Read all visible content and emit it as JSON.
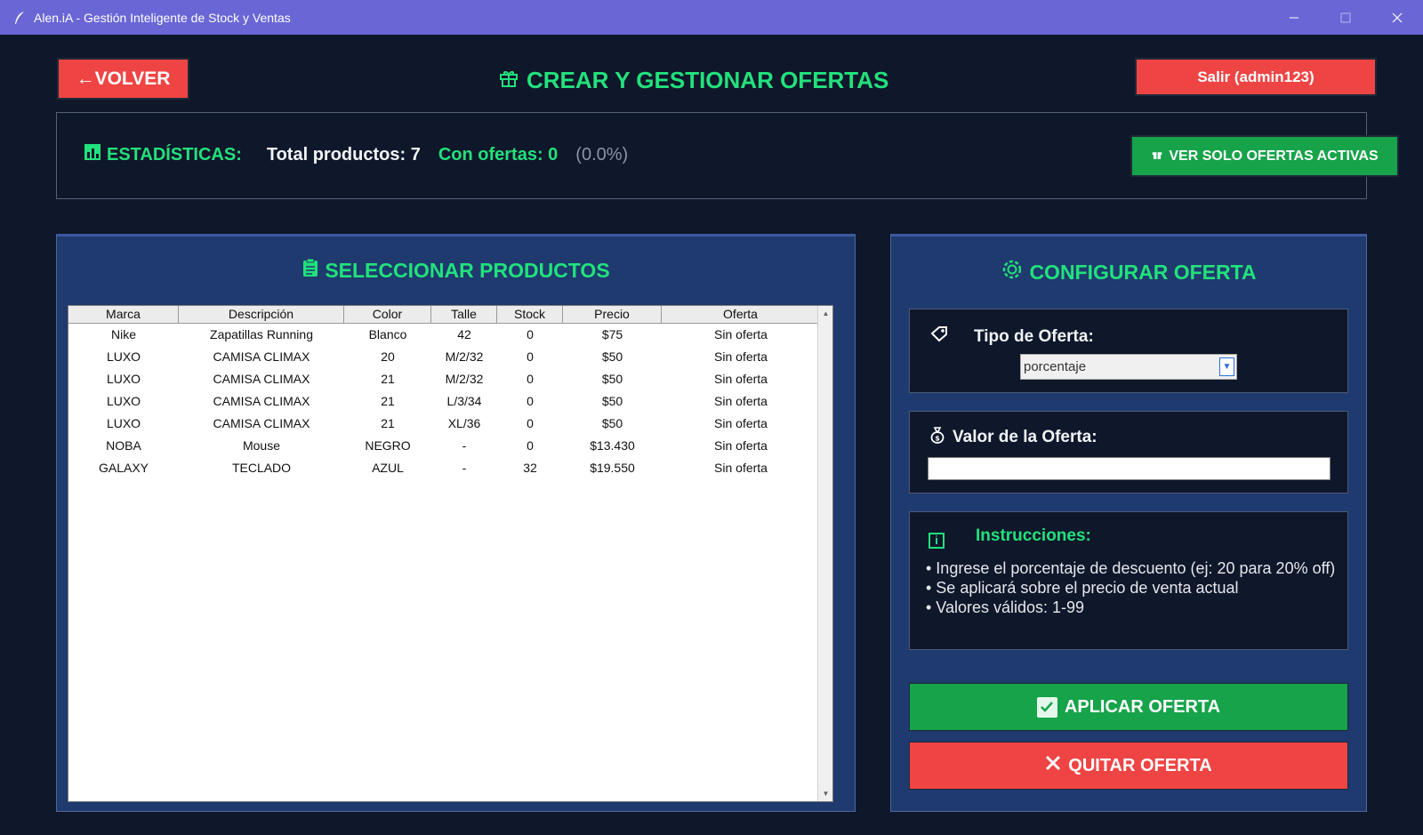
{
  "window": {
    "title": "Alen.iA - Gestión Inteligente de Stock y Ventas",
    "icon": "feather-icon"
  },
  "header": {
    "back_label": "←VOLVER",
    "title": "CREAR Y GESTIONAR OFERTAS",
    "exit_label": "Salir (admin123)"
  },
  "stats": {
    "label": "ESTADÍSTICAS:",
    "total": "Total productos: 7",
    "with_offers": "Con ofertas: 0",
    "percent": "(0.0%)",
    "view_active_label": "VER SOLO OFERTAS ACTIVAS"
  },
  "products": {
    "title": "SELECCIONAR PRODUCTOS",
    "columns": [
      "Marca",
      "Descripción",
      "Color",
      "Talle",
      "Stock",
      "Precio",
      "Oferta"
    ],
    "rows": [
      [
        "Nike",
        "Zapatillas Running",
        "Blanco",
        "42",
        "0",
        "$75",
        "Sin oferta"
      ],
      [
        "LUXO",
        "CAMISA CLIMAX",
        "20",
        "M/2/32",
        "0",
        "$50",
        "Sin oferta"
      ],
      [
        "LUXO",
        "CAMISA CLIMAX",
        "21",
        "M/2/32",
        "0",
        "$50",
        "Sin oferta"
      ],
      [
        "LUXO",
        "CAMISA CLIMAX",
        "21",
        "L/3/34",
        "0",
        "$50",
        "Sin oferta"
      ],
      [
        "LUXO",
        "CAMISA CLIMAX",
        "21",
        "XL/36",
        "0",
        "$50",
        "Sin oferta"
      ],
      [
        "NOBA",
        "Mouse",
        "NEGRO",
        "-",
        "0",
        "$13.430",
        "Sin oferta"
      ],
      [
        "GALAXY",
        "TECLADO",
        "AZUL",
        "-",
        "32",
        "$19.550",
        "Sin oferta"
      ]
    ]
  },
  "config": {
    "title": "CONFIGURAR OFERTA",
    "type_label": "Tipo de Oferta:",
    "type_value": "porcentaje",
    "value_label": "Valor de la Oferta:",
    "value_input": "",
    "instructions_title": "Instrucciones:",
    "instructions": [
      "• Ingrese el porcentaje de descuento (ej: 20 para 20% off)",
      "• Se aplicará sobre el precio de venta actual",
      "• Valores válidos: 1-99"
    ],
    "apply_label": "APLICAR OFERTA",
    "remove_label": "QUITAR OFERTA"
  },
  "colors": {
    "background": "#0f172a",
    "panel": "#1e3a6e",
    "accent_green": "#22e17c",
    "button_green": "#16a34a",
    "button_red": "#ef4444",
    "titlebar": "#6a66d6"
  }
}
